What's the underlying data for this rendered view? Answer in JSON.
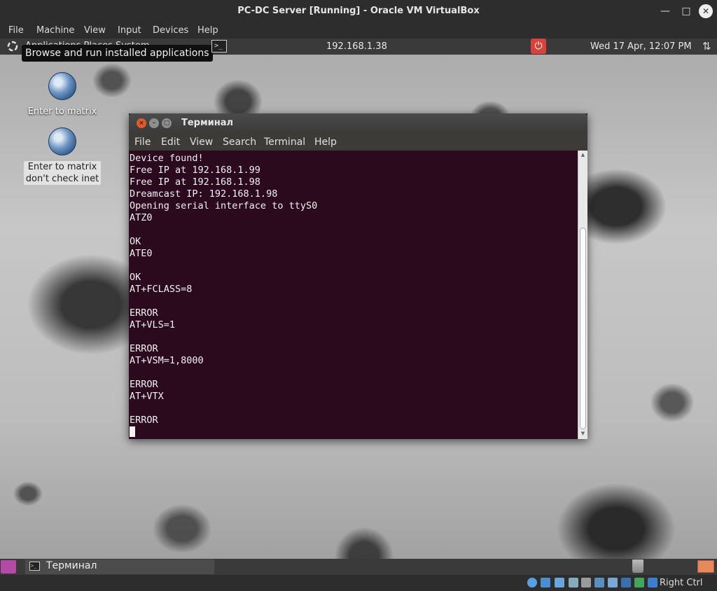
{
  "host": {
    "title": "PC-DC Server [Running] - Oracle VM VirtualBox",
    "menu": [
      "File",
      "Machine",
      "View",
      "Input",
      "Devices",
      "Help"
    ],
    "host_key": "Right Ctrl"
  },
  "guest_panel": {
    "apps_label": "Applications  Places  System",
    "tooltip": "Browse and run installed applications",
    "ip": "192.168.1.38",
    "clock": "Wed 17 Apr, 12:07 PM"
  },
  "desktop": {
    "icons": [
      {
        "label": "Enter to matrix"
      },
      {
        "label_line1": "Enter to matrix",
        "label_line2": "don't check inet"
      }
    ]
  },
  "terminal": {
    "title": "Терминал",
    "menu": [
      "File",
      "Edit",
      "View",
      "Search",
      "Terminal",
      "Help"
    ],
    "output": "Device found!\nFree IP at 192.168.1.99\nFree IP at 192.168.1.98\nDreamcast IP: 192.168.1.98\nOpening serial interface to ttyS0\nATZ0\n\nOK\nATE0\n\nOK\nAT+FCLASS=8\n\nERROR\nAT+VLS=1\n\nERROR\nAT+VSM=1,8000\n\nERROR\nAT+VTX\n\nERROR\n"
  },
  "taskbar": {
    "window_button": "Терминал"
  },
  "colors": {
    "terminal_bg": "#2c0a1e",
    "power_button": "#d8423a"
  }
}
